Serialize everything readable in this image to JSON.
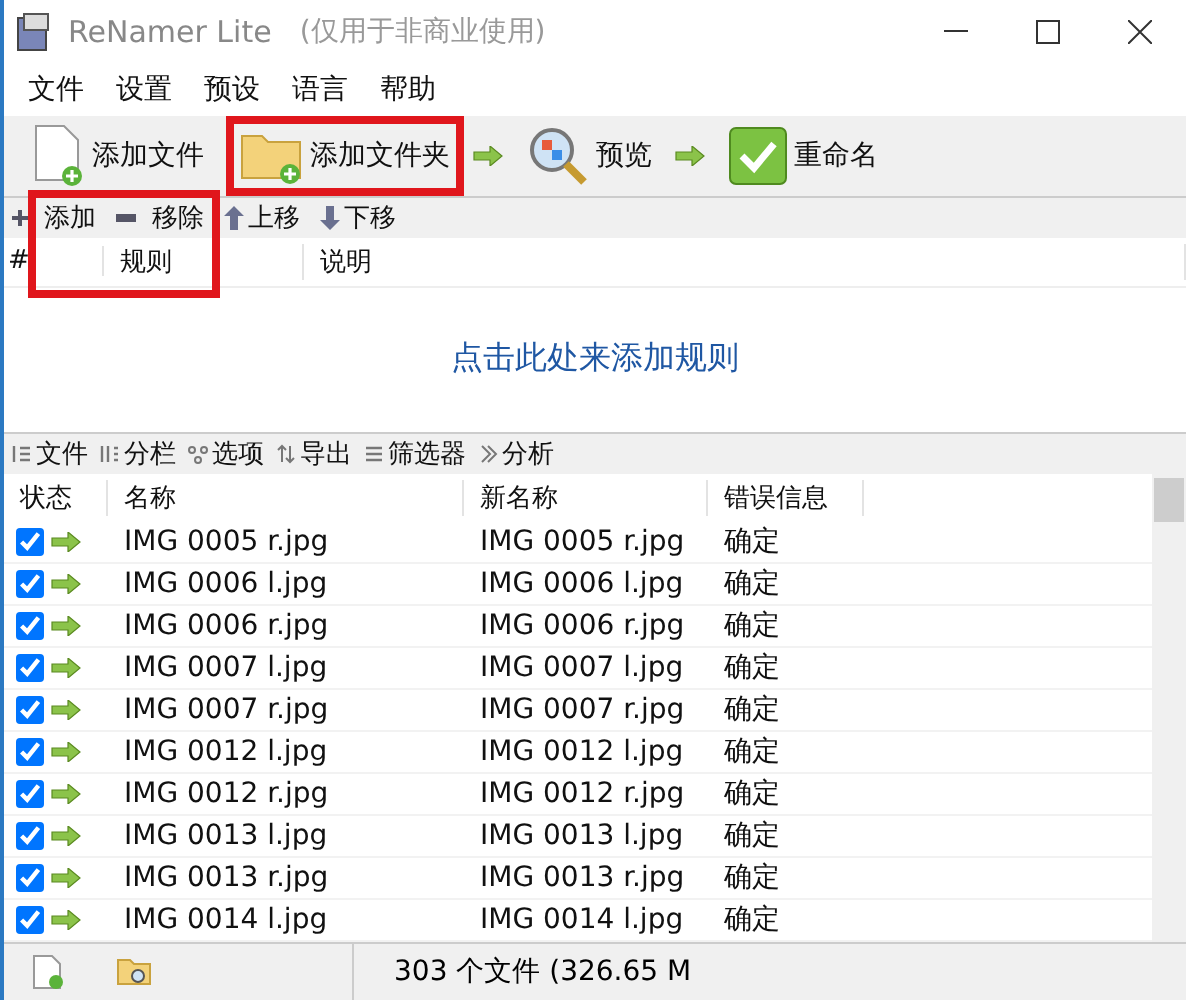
{
  "window": {
    "title": "ReNamer Lite",
    "subtitle": "(仅用于非商业使用)"
  },
  "menu": [
    "文件",
    "设置",
    "预设",
    "语言",
    "帮助"
  ],
  "toolbar": [
    {
      "kind": "file",
      "label": "添加文件",
      "highlighted": false
    },
    {
      "kind": "folder",
      "label": "添加文件夹",
      "highlighted": true
    },
    {
      "kind": "preview",
      "label": "预览",
      "highlighted": false
    },
    {
      "kind": "rename",
      "label": "重命名",
      "highlighted": false
    }
  ],
  "rules_toolbar": {
    "highlighted": true,
    "items": [
      {
        "kind": "add",
        "label": "添加"
      },
      {
        "kind": "remove",
        "label": "移除"
      },
      {
        "kind": "up",
        "label": "上移"
      },
      {
        "kind": "down",
        "label": "下移"
      }
    ]
  },
  "rules_columns": [
    "#",
    "规则",
    "说明"
  ],
  "rules_empty": "点击此处来添加规则",
  "files_toolbar": [
    {
      "kind": "file",
      "label": "文件"
    },
    {
      "kind": "columns",
      "label": "分栏"
    },
    {
      "kind": "options",
      "label": "选项"
    },
    {
      "kind": "export",
      "label": "导出"
    },
    {
      "kind": "filter",
      "label": "筛选器"
    },
    {
      "kind": "analyze",
      "label": "分析"
    }
  ],
  "files_columns": [
    "状态",
    "名称",
    "新名称",
    "错误信息"
  ],
  "files": [
    {
      "checked": true,
      "name": "IMG 0005 r.jpg",
      "new_name": "IMG 0005 r.jpg",
      "error": "确定"
    },
    {
      "checked": true,
      "name": "IMG 0006 l.jpg",
      "new_name": "IMG 0006 l.jpg",
      "error": "确定"
    },
    {
      "checked": true,
      "name": "IMG 0006 r.jpg",
      "new_name": "IMG 0006 r.jpg",
      "error": "确定"
    },
    {
      "checked": true,
      "name": "IMG 0007 l.jpg",
      "new_name": "IMG 0007 l.jpg",
      "error": "确定"
    },
    {
      "checked": true,
      "name": "IMG 0007 r.jpg",
      "new_name": "IMG 0007 r.jpg",
      "error": "确定"
    },
    {
      "checked": true,
      "name": "IMG 0012 l.jpg",
      "new_name": "IMG 0012 l.jpg",
      "error": "确定"
    },
    {
      "checked": true,
      "name": "IMG 0012 r.jpg",
      "new_name": "IMG 0012 r.jpg",
      "error": "确定"
    },
    {
      "checked": true,
      "name": "IMG 0013 l.jpg",
      "new_name": "IMG 0013 l.jpg",
      "error": "确定"
    },
    {
      "checked": true,
      "name": "IMG 0013 r.jpg",
      "new_name": "IMG 0013 r.jpg",
      "error": "确定"
    },
    {
      "checked": true,
      "name": "IMG 0014 l.jpg",
      "new_name": "IMG 0014 l.jpg",
      "error": "确定"
    }
  ],
  "status_bar": {
    "text": "303 个文件 (326.65 M"
  }
}
